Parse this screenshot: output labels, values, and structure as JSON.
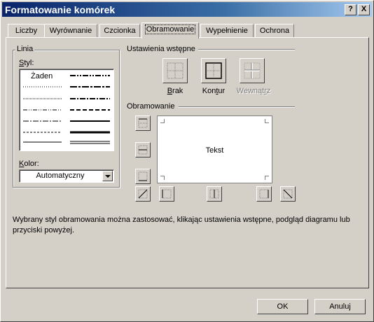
{
  "window": {
    "title": "Formatowanie komórek",
    "help_label": "?",
    "close_label": "X"
  },
  "tabs": [
    {
      "label": "Liczby"
    },
    {
      "label": "Wyrównanie"
    },
    {
      "label": "Czcionka"
    },
    {
      "label": "Obramowanie",
      "active": true
    },
    {
      "label": "Wypełnienie"
    },
    {
      "label": "Ochrona"
    }
  ],
  "line_group": {
    "title": "Linia",
    "style_label": "Styl:",
    "none_label": "Żaden",
    "color_label": "Kolor:",
    "color_value": "Automatyczny"
  },
  "presets": {
    "title": "Ustawienia wstępne",
    "buttons": [
      {
        "label": "Brak",
        "icon": "border-none-icon"
      },
      {
        "label": "Kontur",
        "icon": "border-outline-icon"
      },
      {
        "label": "Wewnątrz",
        "icon": "border-inside-icon",
        "disabled": true
      }
    ]
  },
  "border": {
    "title": "Obramowanie",
    "preview_text": "Tekst"
  },
  "description": "Wybrany styl obramowania można zastosować, klikając ustawienia wstępne, podgląd diagramu lub przyciski powyżej.",
  "footer": {
    "ok_label": "OK",
    "cancel_label": "Anuluj"
  },
  "colors": {
    "title_start": "#0a246a",
    "title_end": "#a6caf0",
    "face": "#d4d0c8",
    "disabled_text": "#808080"
  }
}
